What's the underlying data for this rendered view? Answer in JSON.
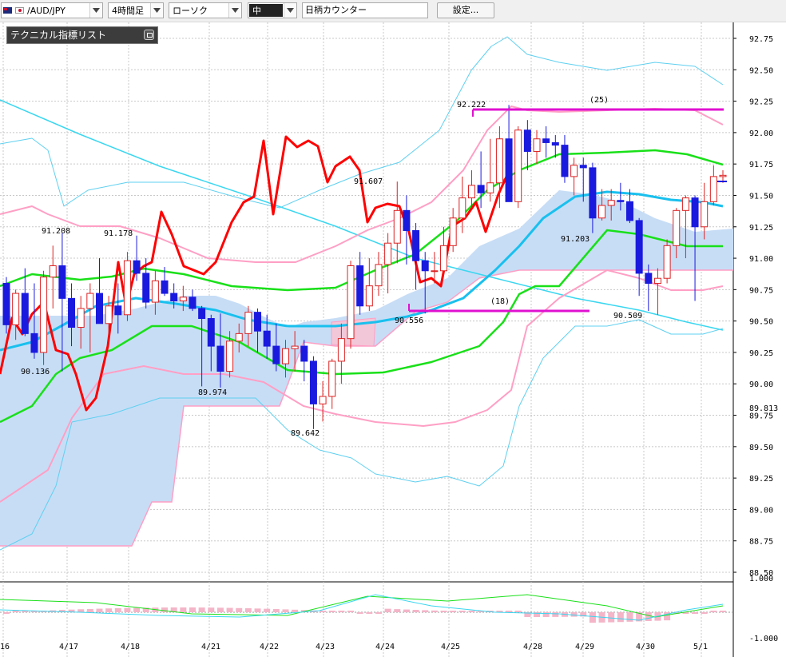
{
  "toolbar": {
    "symbol": "/AUD/JPY",
    "timeframe": "4時間足",
    "chart_type": "ローソク",
    "line_width": "中",
    "counter_label": "日柄カウンター",
    "settings_button": "設定..."
  },
  "indicator_panel": {
    "title": "テクニカル指標リスト"
  },
  "price_axis": {
    "main_ticks": [
      "92.75",
      "92.50",
      "92.25",
      "92.00",
      "91.75",
      "91.50",
      "91.25",
      "91.00",
      "90.75",
      "90.50",
      "90.25",
      "90.00",
      "89.75",
      "89.50",
      "89.25",
      "89.00",
      "88.75",
      "88.50"
    ],
    "current_marker": "89.813",
    "osc_ticks": [
      "1.000",
      "-1.000"
    ]
  },
  "date_axis": [
    "/16",
    "4/17",
    "4/18",
    "4/21",
    "4/22",
    "4/23",
    "4/24",
    "4/25",
    "4/28",
    "4/29",
    "4/30",
    "5/1"
  ],
  "annotations": {
    "highs": [
      "91.208",
      "91.178",
      "91.607",
      "92.222"
    ],
    "lows": [
      "90.136",
      "89.974",
      "89.642",
      "90.556",
      "91.203",
      "90.509"
    ],
    "count_25": "(25)",
    "count_18": "(18)"
  },
  "colors": {
    "bull": "#dd2222",
    "bear": "#1a1adf",
    "rsi_line": "#ff0000",
    "ma_long": "#3ad7f0",
    "ma_mid": "#19c0ee",
    "ma_green": "#19e019",
    "bollinger": "#ff9fc4",
    "bollinger_outer": "#5fd0f0",
    "cloud": "#c7ddf6",
    "cloud_red": "#f2c7d7",
    "counter_line": "#e010d0"
  },
  "chart_data": {
    "type": "candlestick",
    "title": "",
    "ylim": [
      88.45,
      92.85
    ],
    "categories": [
      "/16",
      "4/17",
      "4/18",
      "4/21",
      "4/22",
      "4/23",
      "4/24",
      "4/25",
      "4/28",
      "4/29",
      "4/30",
      "5/1"
    ],
    "candles": [
      [
        90.8,
        90.85,
        90.4,
        90.47
      ],
      [
        90.47,
        90.75,
        90.35,
        90.72
      ],
      [
        90.72,
        90.92,
        90.38,
        90.4
      ],
      [
        90.4,
        90.8,
        90.2,
        90.25
      ],
      [
        90.25,
        90.9,
        90.15,
        90.85
      ],
      [
        90.85,
        91.1,
        90.6,
        90.94
      ],
      [
        90.94,
        91.2,
        90.1,
        90.68
      ],
      [
        90.68,
        90.8,
        90.3,
        90.45
      ],
      [
        90.45,
        90.7,
        90.28,
        90.6
      ],
      [
        90.6,
        90.8,
        90.25,
        90.72
      ],
      [
        90.72,
        91.0,
        90.5,
        90.48
      ],
      [
        90.48,
        90.7,
        90.35,
        90.62
      ],
      [
        90.62,
        90.8,
        90.4,
        90.55
      ],
      [
        90.55,
        91.05,
        90.5,
        90.98
      ],
      [
        90.98,
        91.18,
        90.82,
        90.88
      ],
      [
        90.88,
        91.0,
        90.6,
        90.65
      ],
      [
        90.65,
        90.9,
        90.55,
        90.82
      ],
      [
        90.82,
        90.93,
        90.7,
        90.72
      ],
      [
        90.72,
        90.8,
        90.6,
        90.66
      ],
      [
        90.66,
        90.78,
        90.58,
        90.69
      ],
      [
        90.69,
        90.75,
        90.58,
        90.6
      ],
      [
        90.6,
        90.62,
        89.98,
        90.52
      ],
      [
        90.52,
        90.55,
        90.1,
        90.3
      ],
      [
        90.3,
        90.56,
        89.97,
        90.1
      ],
      [
        90.1,
        90.42,
        90.05,
        90.34
      ],
      [
        90.34,
        90.48,
        90.25,
        90.4
      ],
      [
        90.4,
        90.62,
        90.3,
        90.57
      ],
      [
        90.57,
        90.6,
        90.25,
        90.42
      ],
      [
        90.42,
        90.55,
        90.2,
        90.3
      ],
      [
        90.3,
        90.48,
        90.1,
        90.16
      ],
      [
        90.16,
        90.35,
        90.05,
        90.28
      ],
      [
        90.28,
        90.42,
        90.1,
        90.3
      ],
      [
        90.3,
        90.35,
        90.02,
        90.18
      ],
      [
        90.18,
        90.22,
        89.64,
        89.84
      ],
      [
        89.84,
        90.02,
        89.7,
        89.9
      ],
      [
        89.9,
        90.2,
        89.8,
        90.18
      ],
      [
        90.18,
        90.48,
        90.0,
        90.36
      ],
      [
        90.36,
        90.98,
        90.28,
        90.94
      ],
      [
        90.94,
        91.05,
        90.55,
        90.62
      ],
      [
        90.62,
        91.0,
        90.58,
        90.78
      ],
      [
        90.78,
        91.05,
        90.7,
        90.95
      ],
      [
        90.95,
        91.2,
        90.72,
        91.12
      ],
      [
        91.12,
        91.61,
        90.96,
        91.38
      ],
      [
        91.38,
        91.5,
        90.95,
        91.22
      ],
      [
        91.22,
        91.28,
        90.75,
        90.98
      ],
      [
        90.98,
        91.05,
        90.56,
        90.9
      ],
      [
        90.9,
        91.05,
        90.8,
        90.9
      ],
      [
        90.9,
        91.25,
        90.88,
        91.1
      ],
      [
        91.1,
        91.4,
        91.05,
        91.32
      ],
      [
        91.32,
        91.65,
        91.2,
        91.48
      ],
      [
        91.48,
        91.7,
        91.4,
        91.58
      ],
      [
        91.58,
        91.85,
        91.4,
        91.52
      ],
      [
        91.52,
        91.95,
        91.45,
        91.6
      ],
      [
        91.6,
        92.05,
        91.4,
        91.95
      ],
      [
        91.95,
        92.22,
        91.5,
        91.45
      ],
      [
        91.45,
        92.05,
        91.4,
        92.02
      ],
      [
        92.02,
        92.1,
        91.7,
        91.85
      ],
      [
        91.85,
        92.02,
        91.75,
        91.95
      ],
      [
        91.95,
        92.05,
        91.8,
        91.92
      ],
      [
        91.92,
        91.98,
        91.8,
        91.9
      ],
      [
        91.9,
        91.98,
        91.6,
        91.65
      ],
      [
        91.65,
        91.8,
        91.5,
        91.74
      ],
      [
        91.74,
        91.8,
        91.45,
        91.72
      ],
      [
        91.72,
        91.76,
        91.2,
        91.32
      ],
      [
        91.32,
        91.55,
        91.3,
        91.42
      ],
      [
        91.42,
        91.55,
        91.3,
        91.46
      ],
      [
        91.46,
        91.6,
        91.38,
        91.45
      ],
      [
        91.45,
        91.55,
        91.28,
        91.3
      ],
      [
        91.3,
        91.32,
        90.7,
        90.88
      ],
      [
        90.88,
        90.95,
        90.58,
        90.8
      ],
      [
        90.8,
        90.92,
        90.55,
        90.84
      ],
      [
        90.84,
        91.15,
        90.8,
        91.1
      ],
      [
        91.1,
        91.4,
        91.0,
        91.38
      ],
      [
        91.38,
        91.5,
        91.0,
        91.48
      ],
      [
        91.48,
        91.5,
        90.66,
        91.25
      ],
      [
        91.25,
        91.6,
        91.15,
        91.45
      ],
      [
        91.45,
        91.74,
        91.42,
        91.65
      ],
      [
        91.65,
        91.7,
        91.6,
        91.66
      ]
    ]
  }
}
